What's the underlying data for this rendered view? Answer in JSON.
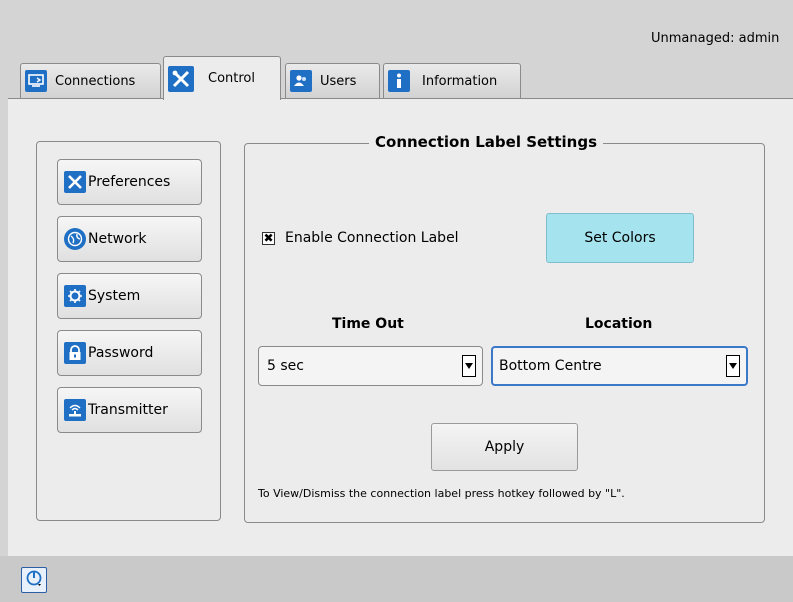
{
  "header": {
    "status_text": "Unmanaged: admin"
  },
  "tabs": [
    {
      "label": "Connections",
      "icon": "monitor-arrow-icon",
      "active": false
    },
    {
      "label": "Control",
      "icon": "tools-icon",
      "active": true
    },
    {
      "label": "Users",
      "icon": "users-icon",
      "active": false
    },
    {
      "label": "Information",
      "icon": "info-icon",
      "active": false
    }
  ],
  "sidebar": {
    "items": [
      {
        "label": "Preferences",
        "icon": "tools-icon"
      },
      {
        "label": "Network",
        "icon": "globe-icon"
      },
      {
        "label": "System",
        "icon": "gear-icon"
      },
      {
        "label": "Password",
        "icon": "padlock-icon"
      },
      {
        "label": "Transmitter",
        "icon": "transmitter-icon"
      }
    ]
  },
  "settings": {
    "title": "Connection Label Settings",
    "enable_label": "Enable Connection Label",
    "enable_checked": true,
    "set_colors_label": "Set Colors",
    "timeout_label": "Time Out",
    "timeout_value": "5 sec",
    "location_label": "Location",
    "location_value": "Bottom Centre",
    "apply_label": "Apply",
    "hint": "To View/Dismiss the connection label press hotkey followed by \"L\"."
  },
  "colors": {
    "accent_blue": "#1f6fc5",
    "set_colors_bg": "#a5e3ef",
    "panel_bg": "#ececec"
  }
}
